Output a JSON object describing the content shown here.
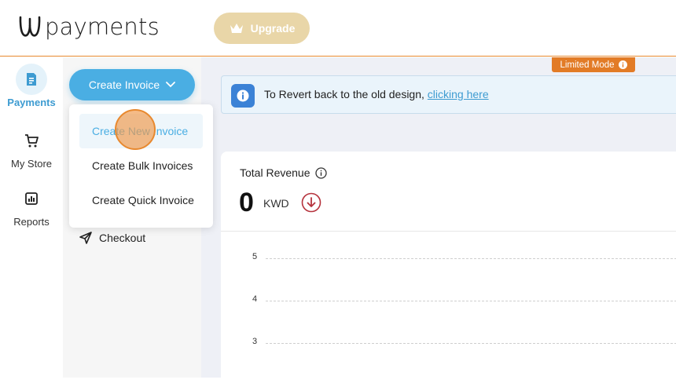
{
  "header": {
    "brand": "payments",
    "upgrade_label": "Upgrade"
  },
  "rail": {
    "items": [
      {
        "label": "Payments",
        "icon": "invoice-icon",
        "active": true
      },
      {
        "label": "My Store",
        "icon": "cart-icon"
      },
      {
        "label": "Reports",
        "icon": "chart-icon"
      }
    ]
  },
  "subnav": {
    "create_label": "Create Invoice",
    "checkout_label": "Checkout"
  },
  "dropdown": {
    "items": [
      {
        "label": "Create New Invoice",
        "active": true
      },
      {
        "label": "Create Bulk Invoices"
      },
      {
        "label": "Create Quick Invoice"
      }
    ]
  },
  "main": {
    "limited_mode_label": "Limited Mode",
    "banner_text": "To Revert back to the old design,",
    "banner_link": "clicking here",
    "revenue_title": "Total Revenue",
    "revenue_value": "0",
    "revenue_currency": "KWD",
    "y_ticks": [
      "5",
      "4",
      "3"
    ]
  },
  "colors": {
    "accent": "#4aaee3",
    "header_border": "#e8892f",
    "limited_badge": "#e27b26",
    "upgrade": "#e9d6a8",
    "down_indicator": "#b5323c"
  }
}
